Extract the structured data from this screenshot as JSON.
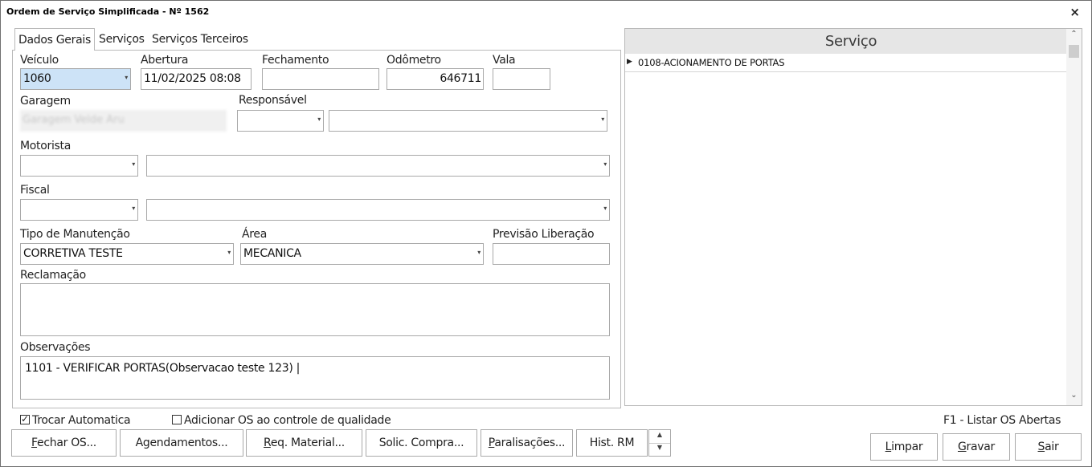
{
  "window": {
    "title": "Ordem de Serviço Simplificada - Nº 1562"
  },
  "tabs": [
    {
      "label": "Dados Gerais",
      "active": true
    },
    {
      "label": "Serviços",
      "active": false
    },
    {
      "label": "Serviços Terceiros",
      "active": false
    }
  ],
  "form": {
    "veiculo": {
      "label": "Veículo",
      "value": "1060"
    },
    "abertura": {
      "label": "Abertura",
      "value": "11/02/2025 08:08"
    },
    "fechamento": {
      "label": "Fechamento",
      "value": ""
    },
    "odometro": {
      "label": "Odômetro",
      "value": "646711"
    },
    "vala": {
      "label": "Vala",
      "value": ""
    },
    "garagem": {
      "label": "Garagem",
      "value": "Garagem Velde Aru"
    },
    "responsavel": {
      "label": "Responsável",
      "code": "",
      "name": ""
    },
    "motorista": {
      "label": "Motorista",
      "code": "",
      "name": ""
    },
    "fiscal": {
      "label": "Fiscal",
      "code": "",
      "name": ""
    },
    "tipo_manutencao": {
      "label": "Tipo de Manutenção",
      "value": "CORRETIVA TESTE"
    },
    "area": {
      "label": "Área",
      "value": "MECANICA"
    },
    "previsao_liberacao": {
      "label": "Previsão Liberação",
      "value": ""
    },
    "reclamacao": {
      "label": "Reclamação",
      "value": ""
    },
    "observacoes": {
      "label": "Observações",
      "value": "1101 - VERIFICAR PORTAS(Observacao teste 123) |"
    }
  },
  "grid": {
    "header": "Serviço",
    "rows": [
      "0108-ACIONAMENTO DE PORTAS"
    ]
  },
  "options": {
    "trocar_automatica": {
      "label": "Trocar Automatica",
      "checked": true
    },
    "adicionar_os": {
      "label": "Adicionar OS ao controle de qualidade",
      "checked": false
    }
  },
  "hint": "F1 - Listar OS Abertas",
  "buttons": {
    "fechar_os": {
      "first": "F",
      "rest": "echar OS..."
    },
    "agendamentos": {
      "label": "Agendamentos..."
    },
    "req_material": {
      "first": "R",
      "rest": "eq. Material..."
    },
    "solic_compra": {
      "label": "Solic. Compra..."
    },
    "paralisacoes": {
      "first": "P",
      "rest": "aralisações..."
    },
    "hist_rm": {
      "label": "Hist. RM"
    },
    "limpar": {
      "first": "L",
      "rest": "impar"
    },
    "gravar": {
      "first": "G",
      "rest": "ravar"
    },
    "sair": {
      "first": "S",
      "rest": "air"
    }
  },
  "icons": {
    "close": "×",
    "dropdown": "▾",
    "row_pointer": "▶",
    "scroll_up": "⌃",
    "scroll_down": "⌄",
    "check": "✓"
  }
}
